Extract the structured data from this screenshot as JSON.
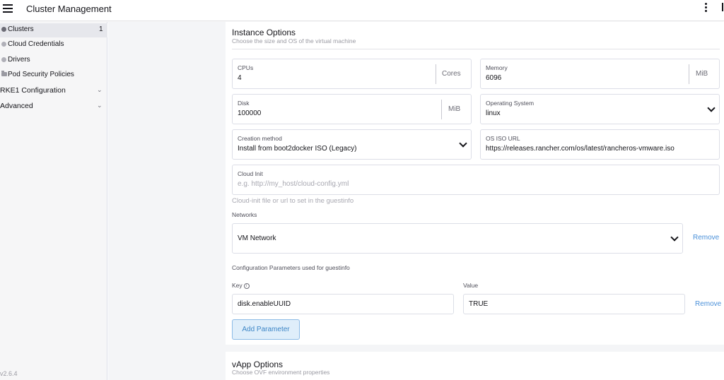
{
  "header": {
    "title": "Cluster Management"
  },
  "sidebar": {
    "items": [
      {
        "label": "Clusters",
        "count": "1"
      },
      {
        "label": "Cloud Credentials"
      },
      {
        "label": "Drivers"
      },
      {
        "label": "Pod Security Policies"
      }
    ],
    "groups": [
      {
        "label": "RKE1 Configuration"
      },
      {
        "label": "Advanced"
      }
    ],
    "version": "v2.6.4"
  },
  "instance": {
    "title": "Instance Options",
    "subtitle": "Choose the size and OS of the virtual machine",
    "cpus": {
      "label": "CPUs",
      "value": "4",
      "unit": "Cores"
    },
    "memory": {
      "label": "Memory",
      "value": "6096",
      "unit": "MiB"
    },
    "disk": {
      "label": "Disk",
      "value": "100000",
      "unit": "MiB"
    },
    "os": {
      "label": "Operating System",
      "value": "linux"
    },
    "creation": {
      "label": "Creation method",
      "value": "Install from boot2docker ISO (Legacy)"
    },
    "iso": {
      "label": "OS ISO URL",
      "value": "https://releases.rancher.com/os/latest/rancheros-vmware.iso"
    },
    "cloudinit": {
      "label": "Cloud Init",
      "placeholder": "e.g. http://my_host/cloud-config.yml",
      "hint": "Cloud-init file or url to set in the guestinfo"
    },
    "networks": {
      "label": "Networks",
      "value": "VM Network",
      "remove": "Remove"
    },
    "config": {
      "label": "Configuration Parameters used for guestinfo",
      "key_label": "Key",
      "value_label": "Value",
      "key": "disk.enableUUID",
      "value": "TRUE",
      "remove": "Remove",
      "add": "Add Parameter"
    }
  },
  "vapp": {
    "title": "vApp Options",
    "subtitle": "Choose OVF environment properties"
  }
}
